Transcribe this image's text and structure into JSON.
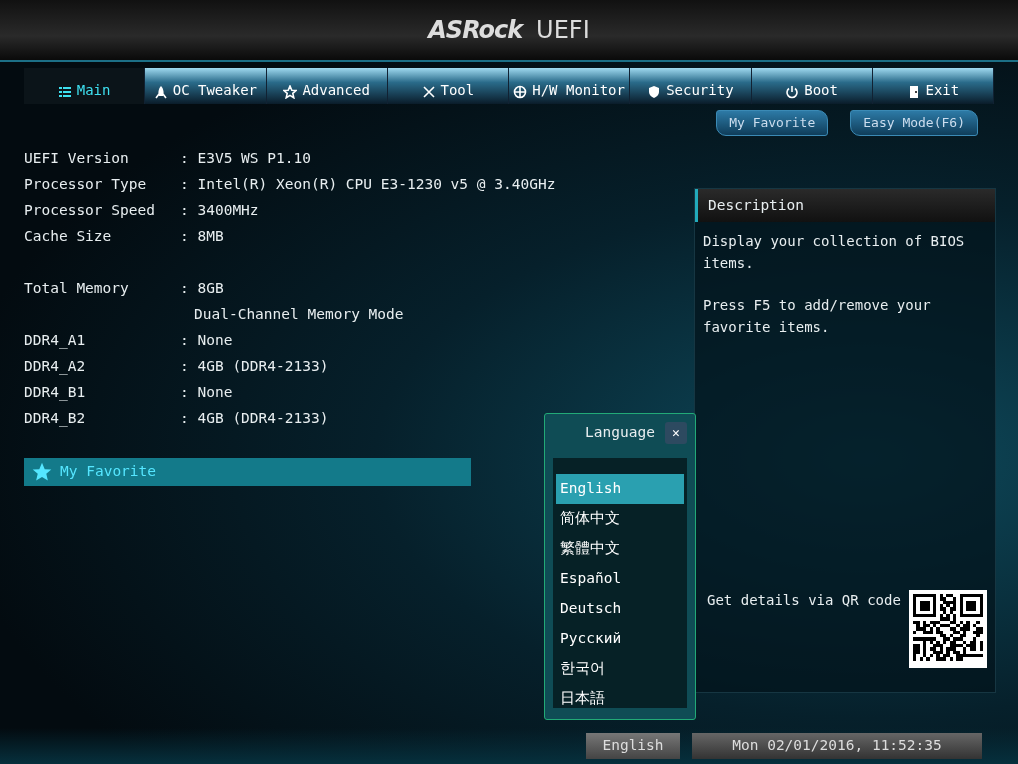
{
  "header": {
    "logo": "ASRock",
    "title": "UEFI"
  },
  "tabs": [
    {
      "label": "Main",
      "selected": true
    },
    {
      "label": "OC Tweaker",
      "selected": false
    },
    {
      "label": "Advanced",
      "selected": false
    },
    {
      "label": "Tool",
      "selected": false
    },
    {
      "label": "H/W Monitor",
      "selected": false
    },
    {
      "label": "Security",
      "selected": false
    },
    {
      "label": "Boot",
      "selected": false
    },
    {
      "label": "Exit",
      "selected": false
    }
  ],
  "top_buttons": [
    "My Favorite",
    "Easy Mode(F6)"
  ],
  "info_groups": [
    [
      {
        "label": "UEFI Version",
        "value": ": E3V5 WS P1.10"
      },
      {
        "label": "Processor Type",
        "value": ": Intel(R) Xeon(R) CPU E3-1230 v5 @ 3.40GHz"
      },
      {
        "label": "Processor Speed",
        "value": ": 3400MHz"
      },
      {
        "label": "Cache Size",
        "value": ": 8MB"
      }
    ],
    [
      {
        "label": "Total Memory",
        "value": ": 8GB"
      },
      {
        "value": "Dual-Channel Memory Mode"
      },
      {
        "label": "DDR4_A1",
        "value": ": None"
      },
      {
        "label": "DDR4_A2",
        "value": ": 4GB (DDR4-2133)"
      },
      {
        "label": "DDR4_B1",
        "value": ": None"
      },
      {
        "label": "DDR4_B2",
        "value": ": 4GB (DDR4-2133)"
      }
    ]
  ],
  "menu_items": [
    {
      "label": "My Favorite",
      "selected": true
    }
  ],
  "description": {
    "title": "Description",
    "paragraphs": [
      "Display your collection of BIOS items.",
      "Press F5 to add/remove your favorite items."
    ],
    "qr_caption": "Get details via QR code"
  },
  "language_dialog": {
    "title": "Language",
    "close": "✕",
    "options": [
      {
        "label": "English",
        "selected": true
      },
      {
        "label": "简体中文",
        "selected": false
      },
      {
        "label": "繁體中文",
        "selected": false
      },
      {
        "label": "Español",
        "selected": false
      },
      {
        "label": "Deutsch",
        "selected": false
      },
      {
        "label": "Русский",
        "selected": false
      },
      {
        "label": "한국어",
        "selected": false
      },
      {
        "label": "日本語",
        "selected": false
      }
    ]
  },
  "status_bar": {
    "language": "English",
    "datetime": "Mon 02/01/2016, 11:52:35"
  }
}
